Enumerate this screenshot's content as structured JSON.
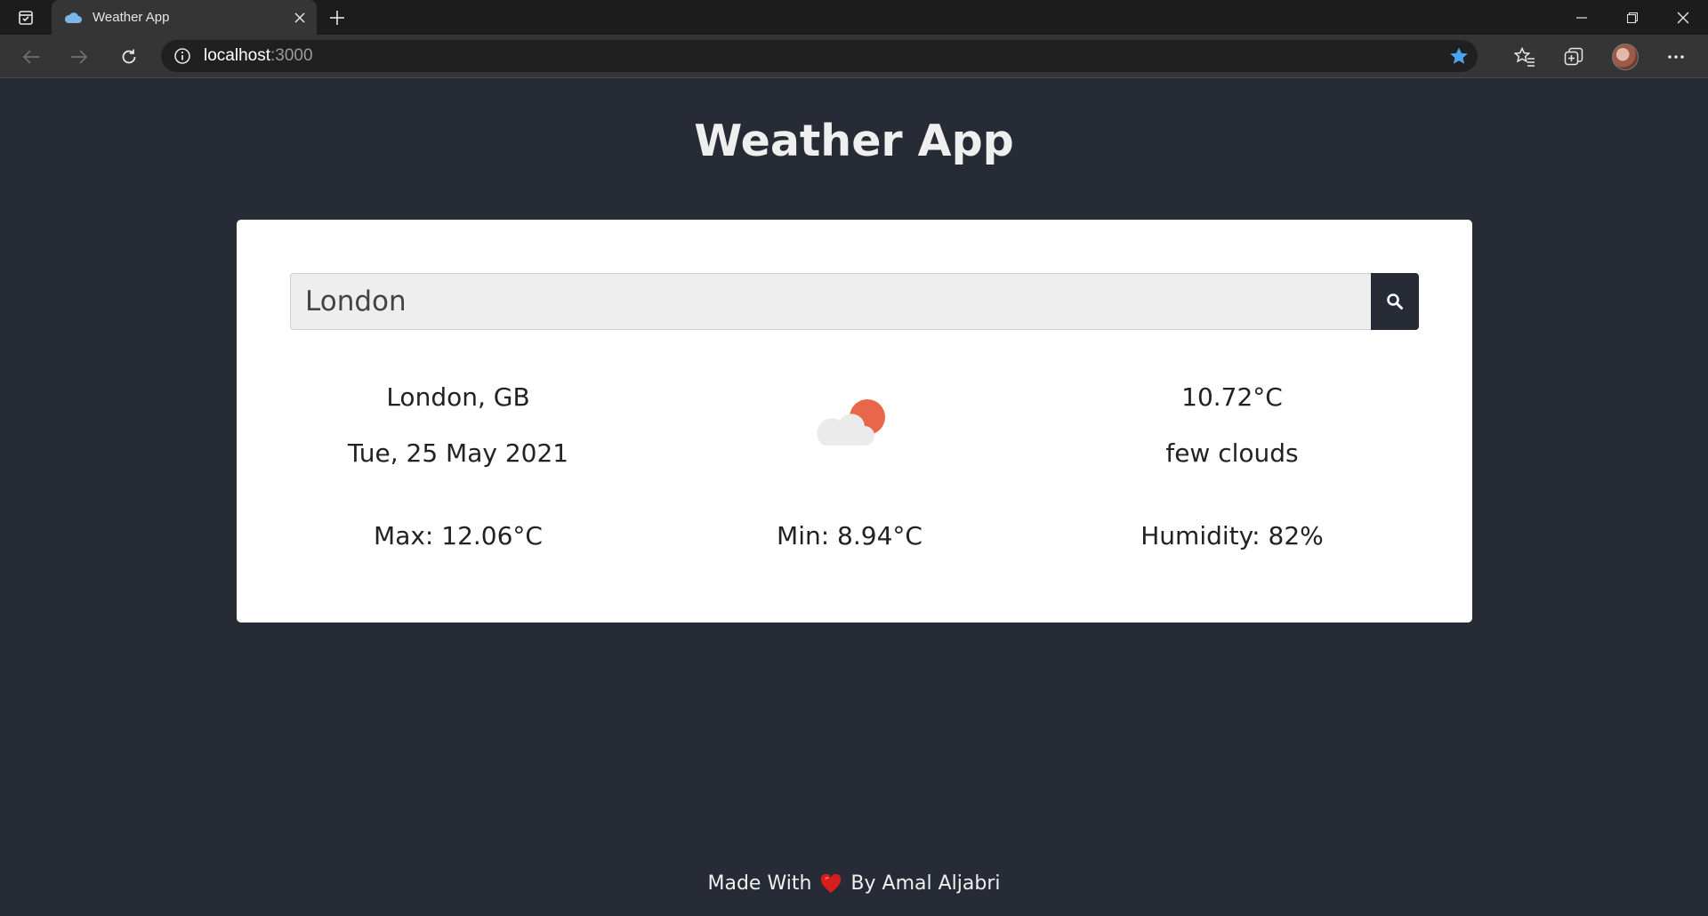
{
  "browser": {
    "tab_title": "Weather App",
    "url_host": "localhost",
    "url_port": ":3000"
  },
  "app": {
    "title": "Weather App",
    "search": {
      "value": "London",
      "placeholder": ""
    },
    "weather": {
      "location": "London, GB",
      "date": "Tue, 25 May 2021",
      "temperature": "10.72°C",
      "description": "few clouds",
      "max": "Max: 12.06°C",
      "min": "Min: 8.94°C",
      "humidity": "Humidity: 82%",
      "icon": "few-clouds-icon"
    }
  },
  "footer": {
    "made_with": "Made With",
    "by": "By Amal Aljabri"
  },
  "colors": {
    "background": "#272b35",
    "card": "#ffffff",
    "accent": "#e8674a",
    "heart": "#d61e1e",
    "star": "#4aa3f0"
  }
}
